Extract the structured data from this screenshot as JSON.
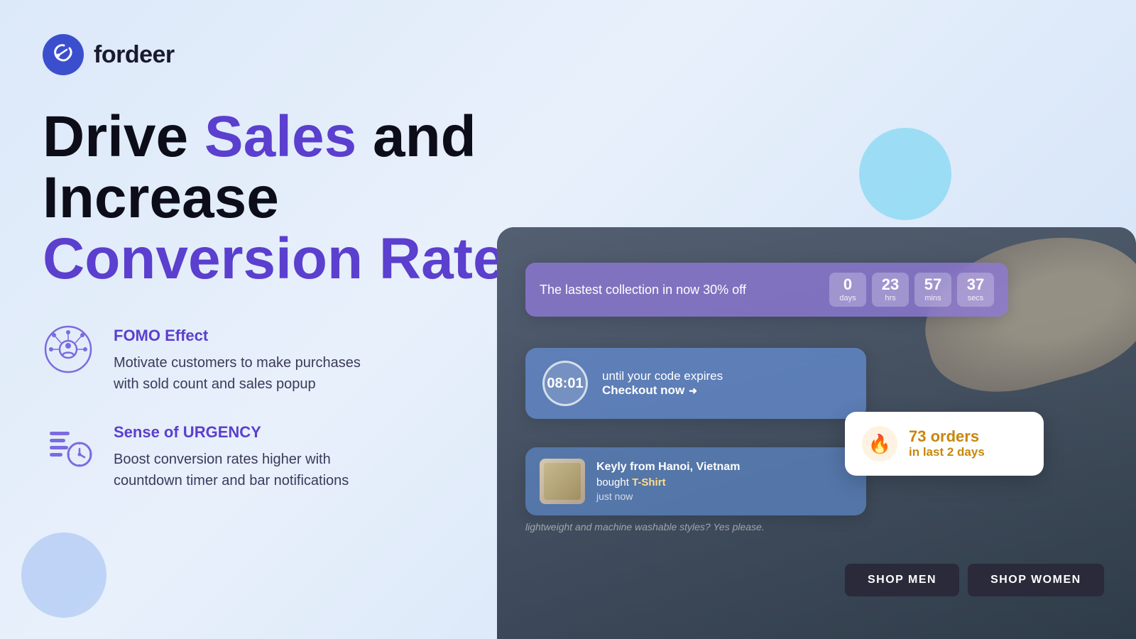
{
  "brand": {
    "name": "fordeer",
    "logo_alt": "Fordeer logo"
  },
  "hero": {
    "line1_black": "Drive ",
    "line1_purple": "Sales",
    "line1_black2": " and Increase",
    "line2_purple": "Conversion Rate"
  },
  "features": [
    {
      "id": "fomo",
      "title": "FOMO Effect",
      "desc_line1": "Motivate customers to make purchases",
      "desc_line2": "with sold count and sales popup"
    },
    {
      "id": "urgency",
      "title": "Sense of URGENCY",
      "desc_line1": "Boost conversion rates higher with",
      "desc_line2": "countdown timer and bar notifications"
    }
  ],
  "countdown_bar": {
    "label": "The lastest collection in now 30% off",
    "units": [
      {
        "value": "0",
        "label": "days"
      },
      {
        "value": "23",
        "label": "hrs"
      },
      {
        "value": "57",
        "label": "mins"
      },
      {
        "value": "37",
        "label": "secs"
      }
    ]
  },
  "timer_popup": {
    "time": "08:01",
    "line1": "until your code expires",
    "line2": "Checkout now"
  },
  "purchase_notif": {
    "buyer": "Keyly from Hanoi, Vietnam",
    "action": "bought",
    "product": "T-Shirt",
    "time": "just now"
  },
  "orders_badge": {
    "count": "73 orders",
    "sub": "in last 2 days",
    "icon": "🔥"
  },
  "shop_buttons": [
    {
      "label": "SHOP MEN"
    },
    {
      "label": "SHOP WOMEN"
    }
  ],
  "bg_text": "lightweight and machine washable styles? Yes please."
}
